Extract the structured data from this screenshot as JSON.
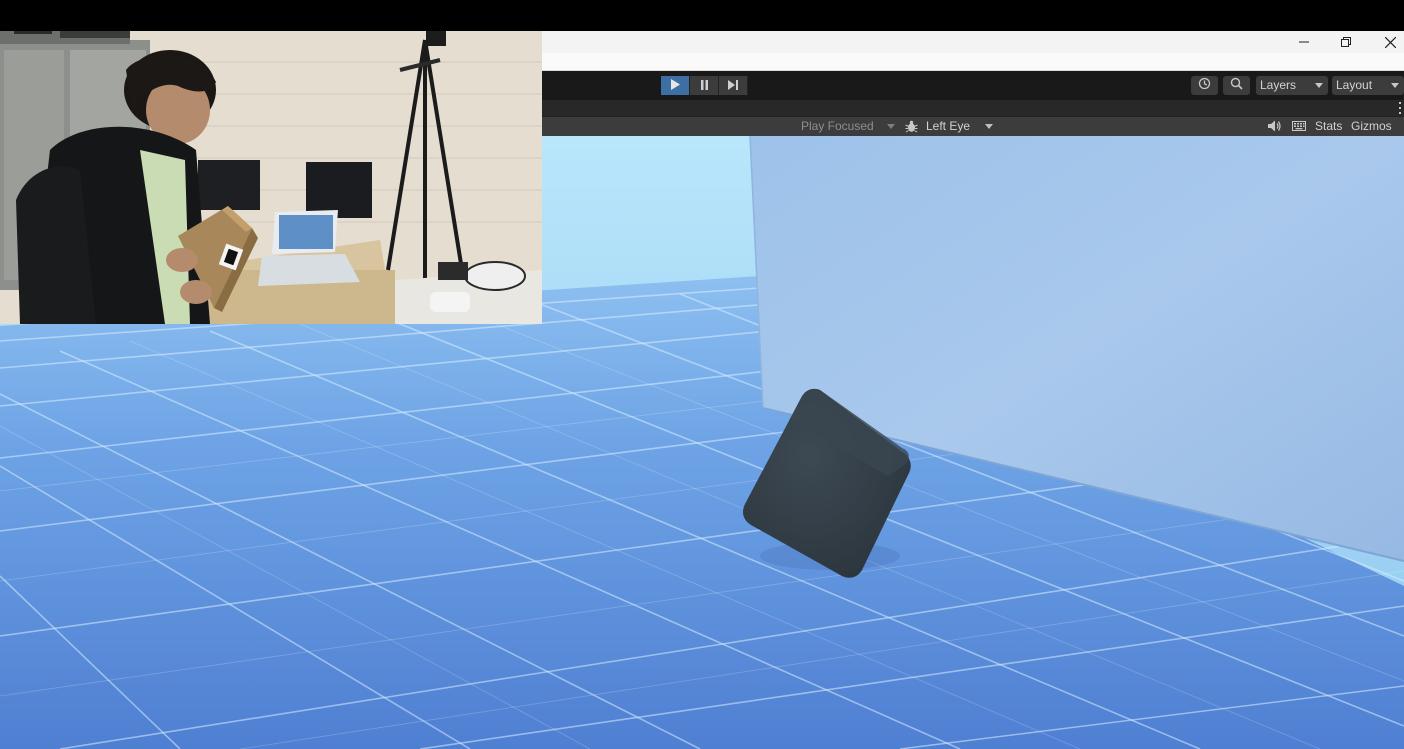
{
  "toolbar": {
    "play_icon": "play-icon",
    "pause_icon": "pause-icon",
    "step_icon": "step-icon",
    "history_icon": "history-icon",
    "search_icon": "search-icon",
    "layers_label": "Layers",
    "layout_label": "Layout"
  },
  "game_view": {
    "play_mode_label": "Play Focused",
    "eye_label": "Left Eye",
    "stats_label": "Stats",
    "gizmos_label": "Gizmos",
    "bug_icon": "bug-icon",
    "audio_icon": "speaker-icon",
    "keyboard_icon": "keyboard-icon"
  },
  "window_controls": {
    "minimize_icon": "minimize-icon",
    "restore_icon": "restore-icon",
    "close_icon": "close-icon"
  },
  "colors": {
    "toolbar_bg": "#191919",
    "header_bg": "#3c3c3c",
    "play_active": "#3d6fa5",
    "sky_top": "#b6e4fa",
    "floor": "#5b8fd8",
    "cube": "#343f48"
  }
}
